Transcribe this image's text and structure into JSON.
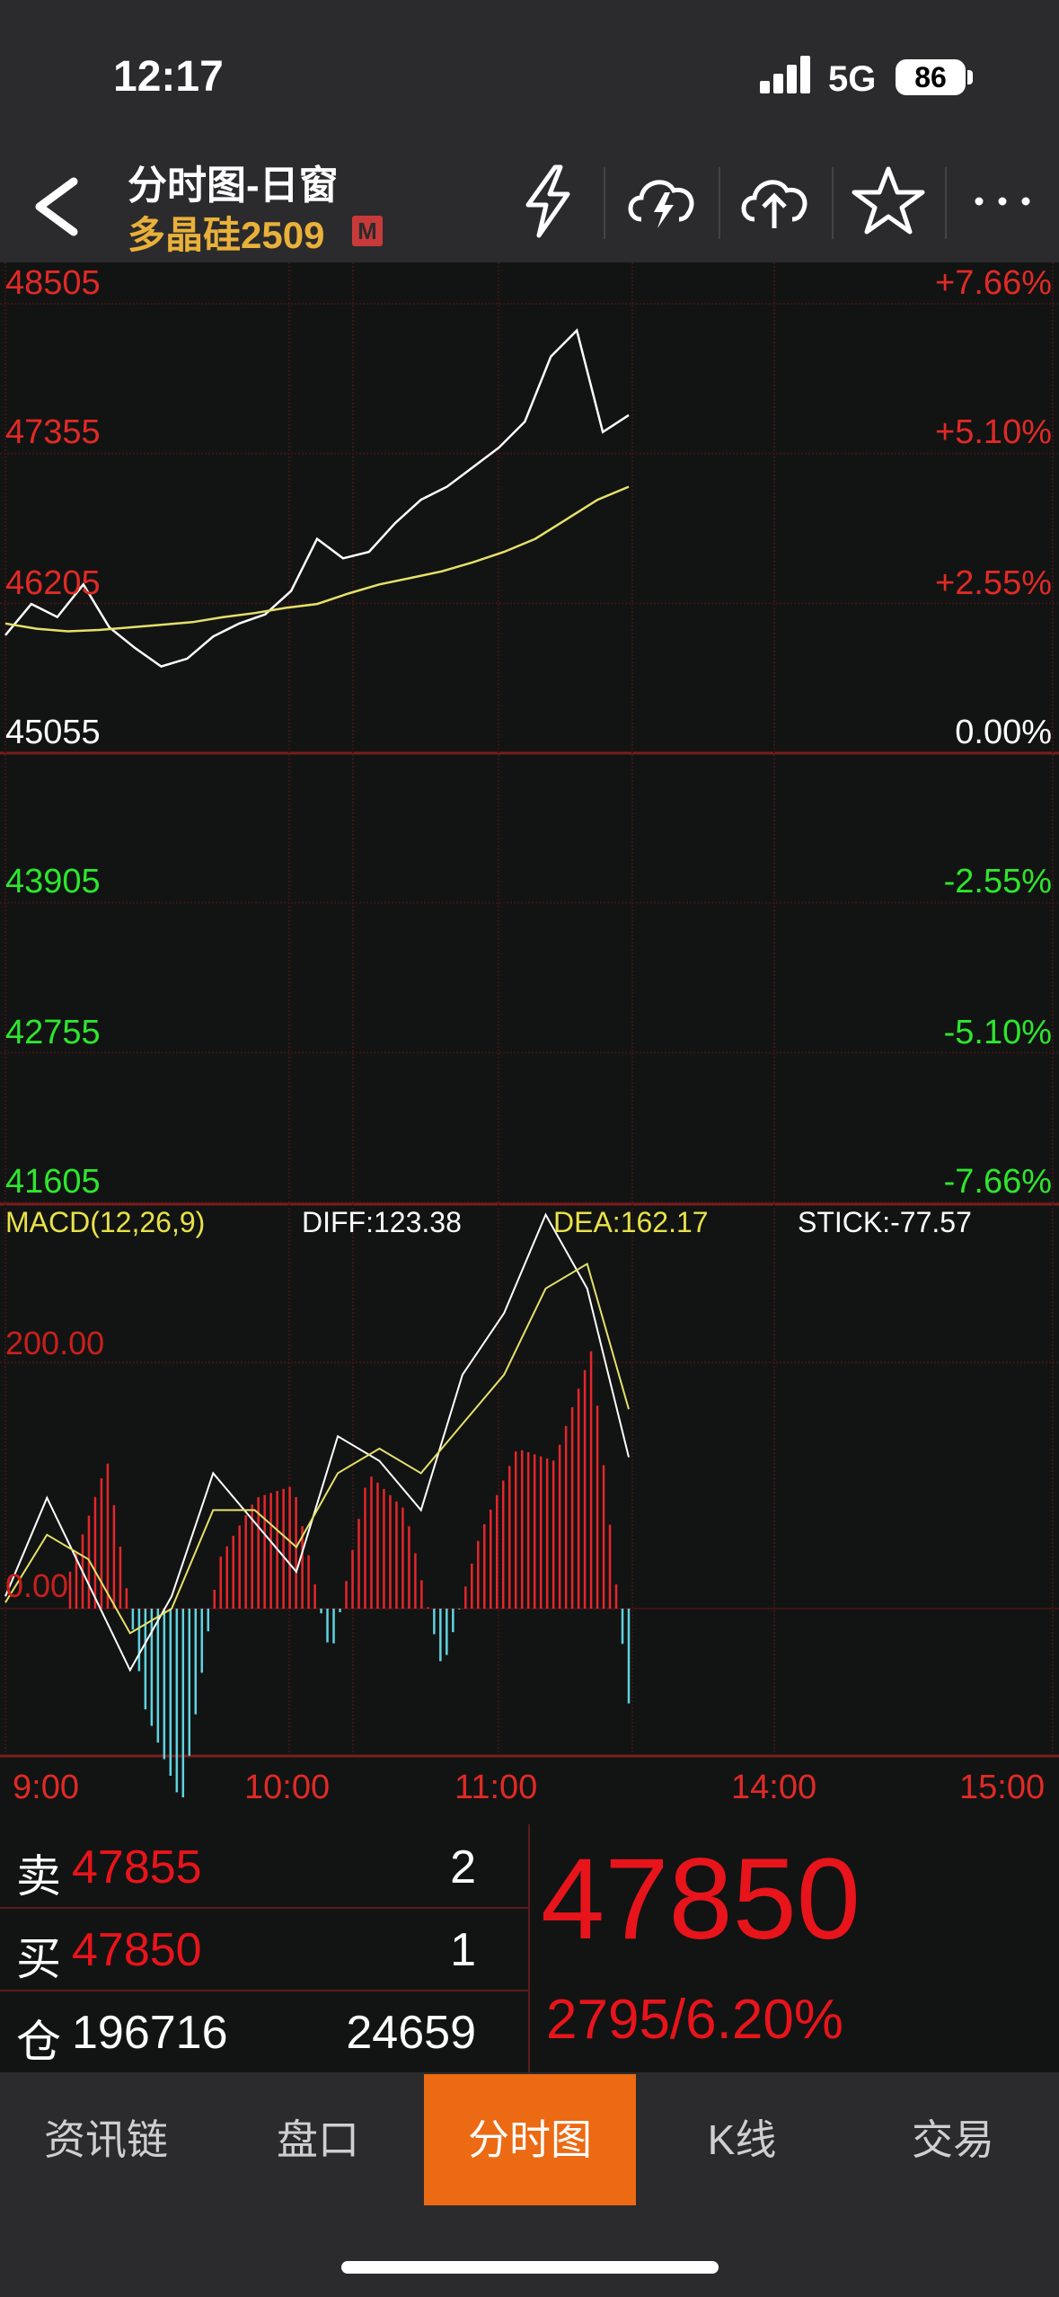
{
  "status_bar": {
    "time": "12:17",
    "network": "5G",
    "battery": "86"
  },
  "header": {
    "title": "分时图-日窗",
    "subtitle": "多晶硅2509",
    "market_badge": "M"
  },
  "price_axis": {
    "left": [
      "48505",
      "47355",
      "46205",
      "45055",
      "43905",
      "42755",
      "41605"
    ],
    "right": [
      "+7.66%",
      "+5.10%",
      "+2.55%",
      "0.00%",
      "-2.55%",
      "-5.10%",
      "-7.66%"
    ]
  },
  "macd_panel": {
    "name": "MACD(12,26,9)",
    "diff": "DIFF:123.38",
    "dea": "DEA:162.17",
    "stick": "STICK:-77.57",
    "level_200": "200.00",
    "level_0": "0.00"
  },
  "time_axis": [
    "9:00",
    "10:00",
    "11:00",
    "14:00",
    "15:00"
  ],
  "quote": {
    "sell_label": "卖",
    "sell_price": "47855",
    "sell_volume": "2",
    "buy_label": "买",
    "buy_price": "47850",
    "buy_volume": "1",
    "oi_label": "仓",
    "open_interest": "196716",
    "oi_extra": "24659",
    "last_price": "47850",
    "change": "2795/6.20%"
  },
  "tabs": [
    "资讯链",
    "盘口",
    "分时图",
    "K线",
    "交易"
  ],
  "active_tab": "分时图",
  "colors": {
    "up": "#e8141b",
    "down": "#2ee62e",
    "accent": "#ec6a13",
    "gold": "#e9b13a",
    "cyan": "#5fd3e0"
  },
  "chart_data": [
    {
      "type": "line",
      "xlabel": "",
      "ylabel": "",
      "ylim": [
        41605,
        48505
      ],
      "x_ticks": [
        "9:00",
        "10:00",
        "11:00",
        "14:00",
        "15:00"
      ],
      "series": [
        {
          "values": [
            45960,
            46200,
            46100,
            46350,
            46020,
            45860,
            45720,
            45780,
            45950,
            46050,
            46120,
            46300,
            46700,
            46550,
            46600,
            46820,
            47000,
            47100,
            47250,
            47400,
            47600,
            48100,
            48300,
            47520,
            47650
          ]
        },
        {
          "values": [
            46050,
            46010,
            45990,
            46000,
            46020,
            46040,
            46060,
            46100,
            46130,
            46170,
            46200,
            46280,
            46350,
            46400,
            46450,
            46520,
            46600,
            46700,
            46850,
            47000,
            47100
          ]
        }
      ]
    },
    {
      "type": "line",
      "title": "MACD(12,26,9)",
      "level_ticks": [
        0,
        200
      ],
      "series": [
        {
          "name": "DIFF",
          "values": [
            10,
            90,
            20,
            -50,
            10,
            110,
            70,
            30,
            140,
            120,
            80,
            190,
            240,
            320,
            260,
            123
          ]
        },
        {
          "name": "DEA",
          "values": [
            5,
            60,
            40,
            -20,
            0,
            80,
            80,
            50,
            110,
            130,
            110,
            150,
            190,
            260,
            280,
            162
          ]
        },
        {
          "name": "STICK",
          "values": [
            30,
            120,
            -80,
            -160,
            40,
            90,
            100,
            -40,
            110,
            80,
            -50,
            60,
            130,
            120,
            210,
            -77
          ]
        }
      ]
    }
  ]
}
